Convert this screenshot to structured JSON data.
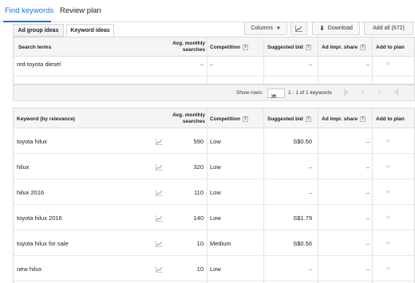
{
  "nav": {
    "find_keywords": "Find keywords",
    "review_plan": "Review plan"
  },
  "toolbar": {
    "columns": "Columns",
    "download": "Download",
    "add_all": "Add all (672)"
  },
  "subtabs": {
    "ad_group_ideas": "Ad group ideas",
    "keyword_ideas": "Keyword ideas"
  },
  "search_table": {
    "headers": {
      "term": "Search terms",
      "searches": "Avg. monthly searches",
      "competition": "Competition",
      "bid": "Suggested bid",
      "share": "Ad impr. share",
      "add": "Add to plan"
    },
    "row": {
      "term": "red toyota diesel",
      "searches": "–",
      "competition": "–",
      "bid": "–",
      "share": "–"
    }
  },
  "pager": {
    "show_rows_label": "Show rows:",
    "rows_value": "30",
    "range": "1 - 1 of 1 keywords"
  },
  "keyword_table": {
    "headers": {
      "keyword": "Keyword (by relevance)",
      "searches": "Avg. monthly searches",
      "competition": "Competition",
      "bid": "Suggested bid",
      "share": "Ad impr. share",
      "add": "Add to plan"
    },
    "rows": [
      {
        "keyword": "toyota hilux",
        "searches": "590",
        "competition": "Low",
        "bid": "S$0.50",
        "share": "–"
      },
      {
        "keyword": "hilux",
        "searches": "320",
        "competition": "Low",
        "bid": "–",
        "share": "–"
      },
      {
        "keyword": "hilux 2016",
        "searches": "110",
        "competition": "Low",
        "bid": "–",
        "share": "–"
      },
      {
        "keyword": "toyota hilux 2016",
        "searches": "140",
        "competition": "Low",
        "bid": "S$1.79",
        "share": "–"
      },
      {
        "keyword": "toyota hilux for sale",
        "searches": "10",
        "competition": "Medium",
        "bid": "S$0.56",
        "share": "–"
      },
      {
        "keyword": "new hilux",
        "searches": "10",
        "competition": "Low",
        "bid": "–",
        "share": "–"
      }
    ]
  },
  "icons": {
    "chart": "trend-chart-icon",
    "add": "add-to-plan-chevron-icon",
    "download": "download-icon",
    "dropdown": "dropdown-caret-icon"
  },
  "colors": {
    "accent": "#1a73e8",
    "header_bg": "#f5f5f5"
  }
}
